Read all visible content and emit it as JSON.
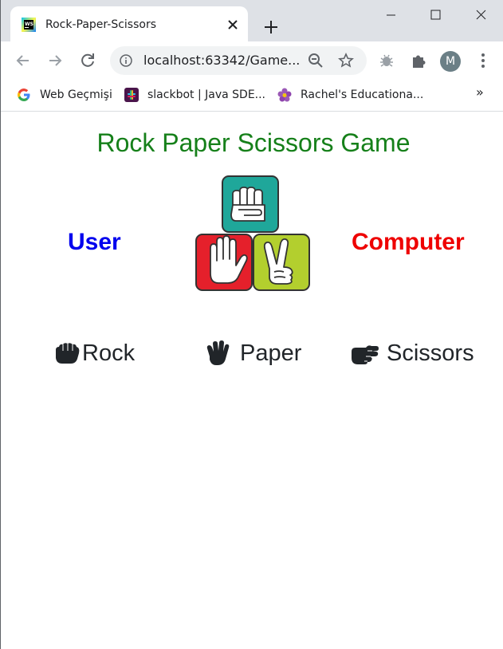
{
  "browser": {
    "tab_title": "Rock-Paper-Scissors",
    "url": "localhost:63342/Game...",
    "avatar_letter": "M",
    "bookmarks": [
      {
        "label": "Web Geçmişi",
        "icon": "google-icon"
      },
      {
        "label": "slackbot | Java SDE...",
        "icon": "slack-icon"
      },
      {
        "label": "Rachel's Educationa...",
        "icon": "flower-icon"
      }
    ],
    "more_bookmarks": "»"
  },
  "page": {
    "title": "Rock Paper Scissors Game",
    "user_label": "User",
    "computer_label": "Computer",
    "choices": [
      {
        "label": "Rock",
        "icon": "hand-rock-icon"
      },
      {
        "label": "Paper",
        "icon": "hand-paper-icon"
      },
      {
        "label": "Scissors",
        "icon": "hand-scissors-icon"
      }
    ]
  },
  "colors": {
    "title": "#16801a",
    "user": "#0000ee",
    "computer": "#ee0000",
    "logo_rock": "#1fa79a",
    "logo_paper": "#e5202b",
    "logo_scissors": "#b3cf2e"
  }
}
